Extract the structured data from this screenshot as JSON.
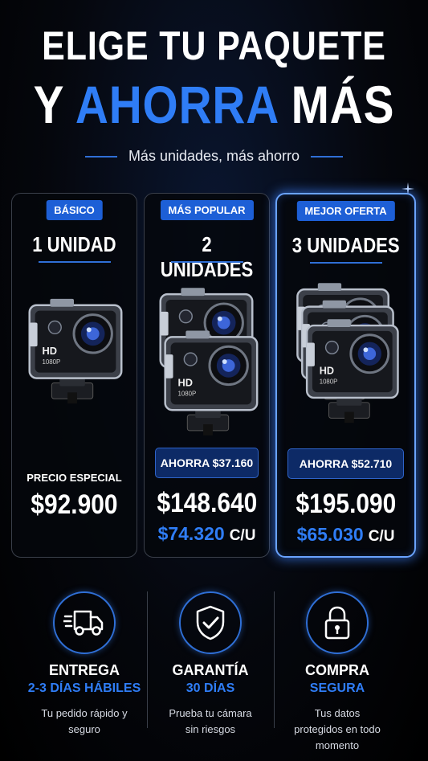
{
  "headline": {
    "line1": "ELIGE TU PAQUETE",
    "line2_prefix": "Y ",
    "line2_accent": "AHORRA",
    "line2_suffix": " MÁS"
  },
  "subheadline": "Más unidades, más ahorro",
  "colors": {
    "accent": "#2f7df6",
    "badge": "#1d5fd6",
    "background": "#05070d"
  },
  "packages": [
    {
      "badge": "BÁSICO",
      "units": "1 UNIDAD",
      "camera_count": 1,
      "camera_label_top": "HD",
      "camera_label_bottom": "1080P",
      "price_caption": "PRECIO ESPECIAL",
      "price": "$92.900"
    },
    {
      "badge": "MÁS POPULAR",
      "units": "2 UNIDADES",
      "camera_count": 2,
      "savings": "AHORRA $37.160",
      "price": "$148.640",
      "unit_price": "$74.320",
      "unit_suffix": "C/U"
    },
    {
      "badge": "MEJOR OFERTA",
      "units": "3 UNIDADES",
      "camera_count": 3,
      "highlighted": true,
      "savings": "AHORRA $52.710",
      "price": "$195.090",
      "unit_price": "$65.030",
      "unit_suffix": "C/U"
    }
  ],
  "features": [
    {
      "icon": "truck-icon",
      "title": "ENTREGA",
      "subtitle": "2-3 DÍAS HÁBILES",
      "description": "Tu pedido rápido y seguro"
    },
    {
      "icon": "shield-check-icon",
      "title": "GARANTÍA",
      "subtitle": "30 DÍAS",
      "description": "Prueba tu cámara sin riesgos"
    },
    {
      "icon": "padlock-icon",
      "title": "COMPRA",
      "subtitle": "SEGURA",
      "description": "Tus datos protegidos en todo momento"
    }
  ]
}
